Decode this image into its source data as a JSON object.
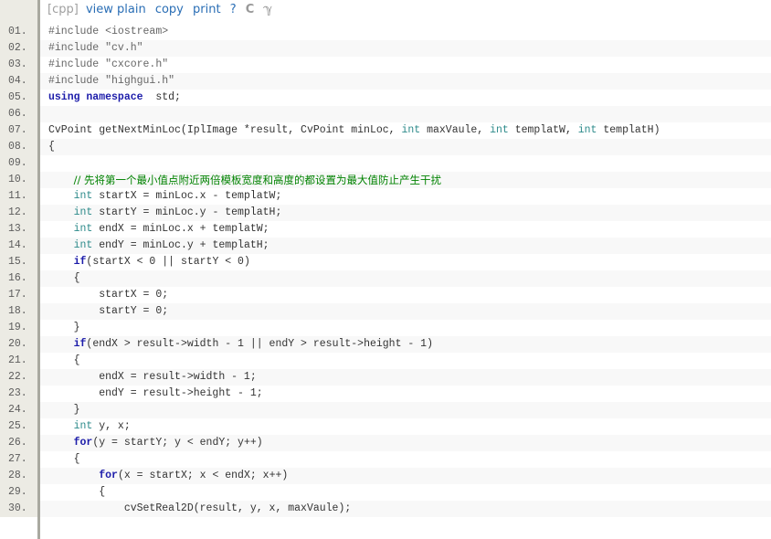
{
  "toolbar": {
    "lang": "[cpp]",
    "view_plain": "view plain",
    "copy": "copy",
    "print": "print",
    "help": "?",
    "icon1": "C",
    "icon2": "ℽ"
  },
  "lines": [
    {
      "n": "01.",
      "t": [
        [
          "pp",
          "#include <iostream>"
        ]
      ]
    },
    {
      "n": "02.",
      "t": [
        [
          "pp",
          "#include \"cv.h\""
        ]
      ]
    },
    {
      "n": "03.",
      "t": [
        [
          "pp",
          "#include \"cxcore.h\""
        ]
      ]
    },
    {
      "n": "04.",
      "t": [
        [
          "pp",
          "#include \"highgui.h\""
        ]
      ]
    },
    {
      "n": "05.",
      "t": [
        [
          "kw",
          "using namespace"
        ],
        [
          "",
          "  std;"
        ]
      ]
    },
    {
      "n": "06.",
      "t": []
    },
    {
      "n": "07.",
      "t": [
        [
          "",
          "CvPoint getNextMinLoc(IplImage *result, CvPoint minLoc, "
        ],
        [
          "ty",
          "int"
        ],
        [
          "",
          " maxVaule, "
        ],
        [
          "ty",
          "int"
        ],
        [
          "",
          " templatW, "
        ],
        [
          "ty",
          "int"
        ],
        [
          "",
          " templatH)"
        ]
      ]
    },
    {
      "n": "08.",
      "t": [
        [
          "",
          "{"
        ]
      ]
    },
    {
      "n": "09.",
      "t": []
    },
    {
      "n": "10.",
      "t": [
        [
          "",
          "    "
        ],
        [
          "cm",
          "// 先将第一个最小值点附近两倍模板宽度和高度的都设置为最大值防止产生干扰"
        ]
      ]
    },
    {
      "n": "11.",
      "t": [
        [
          "",
          "    "
        ],
        [
          "ty",
          "int"
        ],
        [
          "",
          " startX = minLoc.x - templatW;"
        ]
      ]
    },
    {
      "n": "12.",
      "t": [
        [
          "",
          "    "
        ],
        [
          "ty",
          "int"
        ],
        [
          "",
          " startY = minLoc.y - templatH;"
        ]
      ]
    },
    {
      "n": "13.",
      "t": [
        [
          "",
          "    "
        ],
        [
          "ty",
          "int"
        ],
        [
          "",
          " endX = minLoc.x + templatW;"
        ]
      ]
    },
    {
      "n": "14.",
      "t": [
        [
          "",
          "    "
        ],
        [
          "ty",
          "int"
        ],
        [
          "",
          " endY = minLoc.y + templatH;"
        ]
      ]
    },
    {
      "n": "15.",
      "t": [
        [
          "",
          "    "
        ],
        [
          "kw",
          "if"
        ],
        [
          "",
          "(startX < 0 || startY < 0)"
        ]
      ]
    },
    {
      "n": "16.",
      "t": [
        [
          "",
          "    {"
        ]
      ]
    },
    {
      "n": "17.",
      "t": [
        [
          "",
          "        startX = 0;"
        ]
      ]
    },
    {
      "n": "18.",
      "t": [
        [
          "",
          "        startY = 0;"
        ]
      ]
    },
    {
      "n": "19.",
      "t": [
        [
          "",
          "    }"
        ]
      ]
    },
    {
      "n": "20.",
      "t": [
        [
          "",
          "    "
        ],
        [
          "kw",
          "if"
        ],
        [
          "",
          "(endX > result->width - 1 || endY > result->height - 1)"
        ]
      ]
    },
    {
      "n": "21.",
      "t": [
        [
          "",
          "    {"
        ]
      ]
    },
    {
      "n": "22.",
      "t": [
        [
          "",
          "        endX = result->width - 1;"
        ]
      ]
    },
    {
      "n": "23.",
      "t": [
        [
          "",
          "        endY = result->height - 1;"
        ]
      ]
    },
    {
      "n": "24.",
      "t": [
        [
          "",
          "    }"
        ]
      ]
    },
    {
      "n": "25.",
      "t": [
        [
          "",
          "    "
        ],
        [
          "ty",
          "int"
        ],
        [
          "",
          " y, x;"
        ]
      ]
    },
    {
      "n": "26.",
      "t": [
        [
          "",
          "    "
        ],
        [
          "kw",
          "for"
        ],
        [
          "",
          "(y = startY; y < endY; y++)"
        ]
      ]
    },
    {
      "n": "27.",
      "t": [
        [
          "",
          "    {"
        ]
      ]
    },
    {
      "n": "28.",
      "t": [
        [
          "",
          "        "
        ],
        [
          "kw",
          "for"
        ],
        [
          "",
          "(x = startX; x < endX; x++)"
        ]
      ]
    },
    {
      "n": "29.",
      "t": [
        [
          "",
          "        {"
        ]
      ]
    },
    {
      "n": "30.",
      "t": [
        [
          "",
          "            cvSetReal2D(result, y, x, maxVaule);"
        ]
      ]
    }
  ]
}
